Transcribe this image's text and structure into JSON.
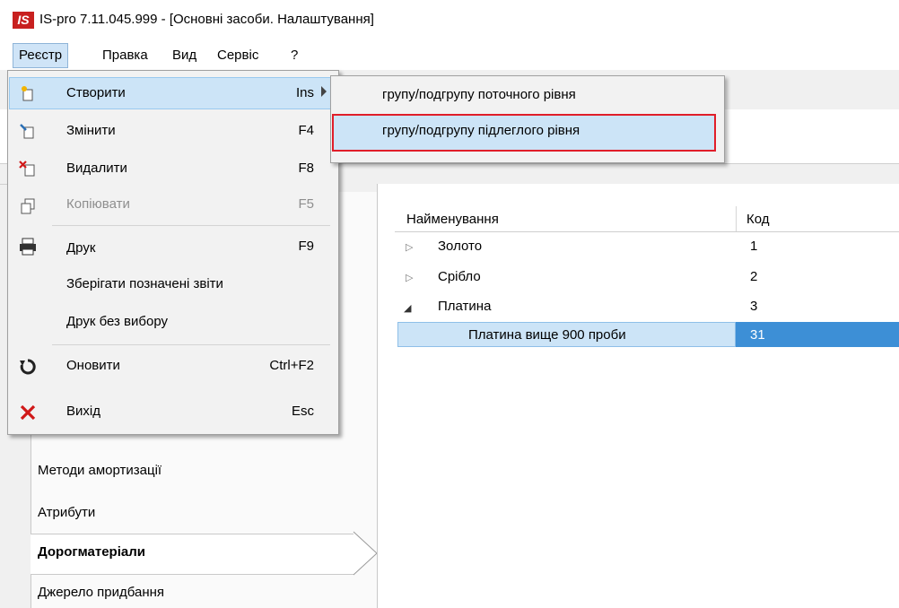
{
  "window": {
    "logo_text": "IS",
    "title": "IS-pro 7.11.045.999 - [Основні засоби. Налаштування]"
  },
  "menubar": {
    "items": [
      "Реєстр",
      "Правка",
      "Вид",
      "Сервіс",
      "?"
    ]
  },
  "dropdown": {
    "items": [
      {
        "label": "Створити",
        "shortcut": "Ins",
        "icon": "create-icon",
        "enabled": true
      },
      {
        "label": "Змінити",
        "shortcut": "F4",
        "icon": "edit-icon",
        "enabled": true
      },
      {
        "label": "Видалити",
        "shortcut": "F8",
        "icon": "delete-icon",
        "enabled": true
      },
      {
        "label": "Копіювати",
        "shortcut": "F5",
        "icon": "copy-icon",
        "enabled": false
      },
      {
        "label": "Друк",
        "shortcut": "F9",
        "icon": "printer-icon",
        "enabled": true
      },
      {
        "label": "Зберігати позначені звіти",
        "shortcut": "",
        "icon": "",
        "enabled": true
      },
      {
        "label": "Друк без вибору",
        "shortcut": "",
        "icon": "",
        "enabled": true
      },
      {
        "label": "Оновити",
        "shortcut": "Ctrl+F2",
        "icon": "refresh-icon",
        "enabled": true
      },
      {
        "label": "Вихід",
        "shortcut": "Esc",
        "icon": "exit-icon",
        "enabled": true
      }
    ]
  },
  "submenu": {
    "items": [
      "групу/подгрупу поточного рівня",
      "групу/подгрупу підлеглого рівня"
    ],
    "highlighted_index": 1
  },
  "left_nav": {
    "items": [
      "Методи амортизації",
      "Атрибути",
      "Дорогматеріали",
      "Джерело придбання"
    ],
    "selected": "Дорогматеріали"
  },
  "grid": {
    "columns": [
      "Найменування",
      "Код"
    ],
    "rows": [
      {
        "name": "Золото",
        "code": "1",
        "expander": "▷"
      },
      {
        "name": "Срібло",
        "code": "2",
        "expander": "▷"
      },
      {
        "name": "Платина",
        "code": "3",
        "expander": "◢"
      },
      {
        "name": "Платина вище 900 проби",
        "code": "31",
        "expander": ""
      }
    ]
  },
  "colors": {
    "logo": "#c8201f",
    "highlight": "#cce4f7",
    "selected_cell": "#3d8fd6",
    "focus_outline": "#e01e2a"
  }
}
